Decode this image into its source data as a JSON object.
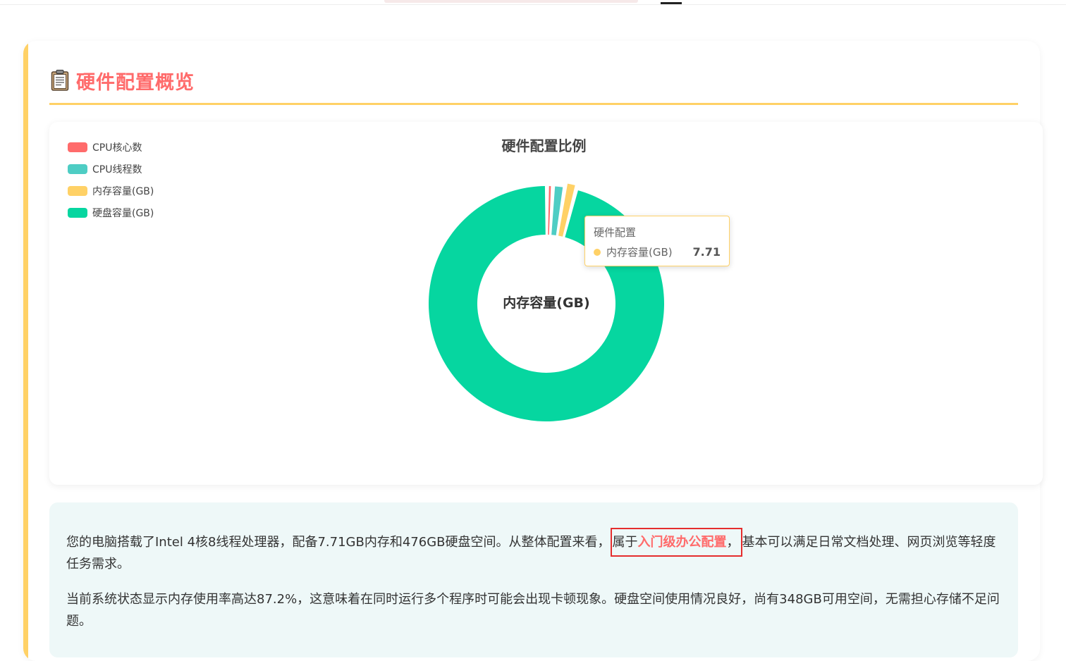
{
  "header": {
    "title": "硬件配置概览",
    "icon": "clipboard-icon"
  },
  "colors": {
    "accent": "#ffd166",
    "title": "#ff6b6b",
    "highlight_border": "#e52d2d",
    "summary_bg": "#eef8f8"
  },
  "chart_data": {
    "type": "pie",
    "title": "硬件配置比例",
    "donut": true,
    "center_label": "内存容量(GB)",
    "legend_position": "top-left",
    "series_name": "硬件配置",
    "categories": [
      "CPU核心数",
      "CPU线程数",
      "内存容量(GB)",
      "硬盘容量(GB)"
    ],
    "values": [
      4,
      8,
      7.71,
      476
    ],
    "colors": [
      "#ff6b6b",
      "#4ecdc4",
      "#ffd166",
      "#06d6a0"
    ],
    "highlighted_index": 2
  },
  "tooltip": {
    "title": "硬件配置",
    "label": "内存容量(GB)",
    "value": "7.71"
  },
  "summary": {
    "p1_before": "您的电脑搭载了Intel 4核8线程处理器，配备7.71GB内存和476GB硬盘空间。从整体配置来看，",
    "p1_box_prefix": "属于",
    "p1_box_emph": "入门级办公配置",
    "p1_box_suffix": "，",
    "p1_after": "基本可以满足日常文档处理、网页浏览等轻度任务需求。",
    "p2": "当前系统状态显示内存使用率高达87.2%，这意味着在同时运行多个程序时可能会出现卡顿现象。硬盘空间使用情况良好，尚有348GB可用空间，无需担心存储不足问题。"
  }
}
